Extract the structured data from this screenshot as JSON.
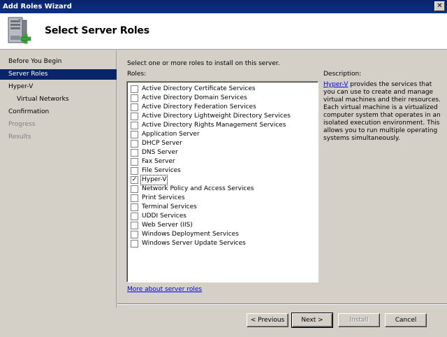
{
  "window": {
    "title": "Add Roles Wizard",
    "close_glyph": "✕"
  },
  "header": {
    "title": "Select Server Roles"
  },
  "nav": {
    "items": [
      {
        "label": "Before You Begin",
        "state": "normal",
        "sub": false
      },
      {
        "label": "Server Roles",
        "state": "active",
        "sub": false
      },
      {
        "label": "Hyper-V",
        "state": "normal",
        "sub": false
      },
      {
        "label": "Virtual Networks",
        "state": "normal",
        "sub": true
      },
      {
        "label": "Confirmation",
        "state": "normal",
        "sub": false
      },
      {
        "label": "Progress",
        "state": "disabled",
        "sub": false
      },
      {
        "label": "Results",
        "state": "disabled",
        "sub": false
      }
    ]
  },
  "main": {
    "instruction": "Select one or more roles to install on this server.",
    "roles_label": "Roles:",
    "roles": [
      {
        "label": "Active Directory Certificate Services",
        "checked": false
      },
      {
        "label": "Active Directory Domain Services",
        "checked": false
      },
      {
        "label": "Active Directory Federation Services",
        "checked": false
      },
      {
        "label": "Active Directory Lightweight Directory Services",
        "checked": false
      },
      {
        "label": "Active Directory Rights Management Services",
        "checked": false
      },
      {
        "label": "Application Server",
        "checked": false
      },
      {
        "label": "DHCP Server",
        "checked": false
      },
      {
        "label": "DNS Server",
        "checked": false
      },
      {
        "label": "Fax Server",
        "checked": false
      },
      {
        "label": "File Services",
        "checked": false
      },
      {
        "label": "Hyper-V",
        "checked": true,
        "focused": true
      },
      {
        "label": "Network Policy and Access Services",
        "checked": false
      },
      {
        "label": "Print Services",
        "checked": false
      },
      {
        "label": "Terminal Services",
        "checked": false
      },
      {
        "label": "UDDI Services",
        "checked": false
      },
      {
        "label": "Web Server (IIS)",
        "checked": false
      },
      {
        "label": "Windows Deployment Services",
        "checked": false
      },
      {
        "label": "Windows Server Update Services",
        "checked": false
      }
    ],
    "more_link": "More about server roles",
    "description_label": "Description:",
    "description_link": "Hyper-V",
    "description_text": " provides the services that you can use to create and manage virtual machines and their resources. Each virtual machine is a virtualized computer system that operates in an isolated execution environment. This allows you to run multiple operating systems simultaneously."
  },
  "buttons": {
    "previous": "< Previous",
    "next": "Next >",
    "install": "Install",
    "cancel": "Cancel"
  }
}
